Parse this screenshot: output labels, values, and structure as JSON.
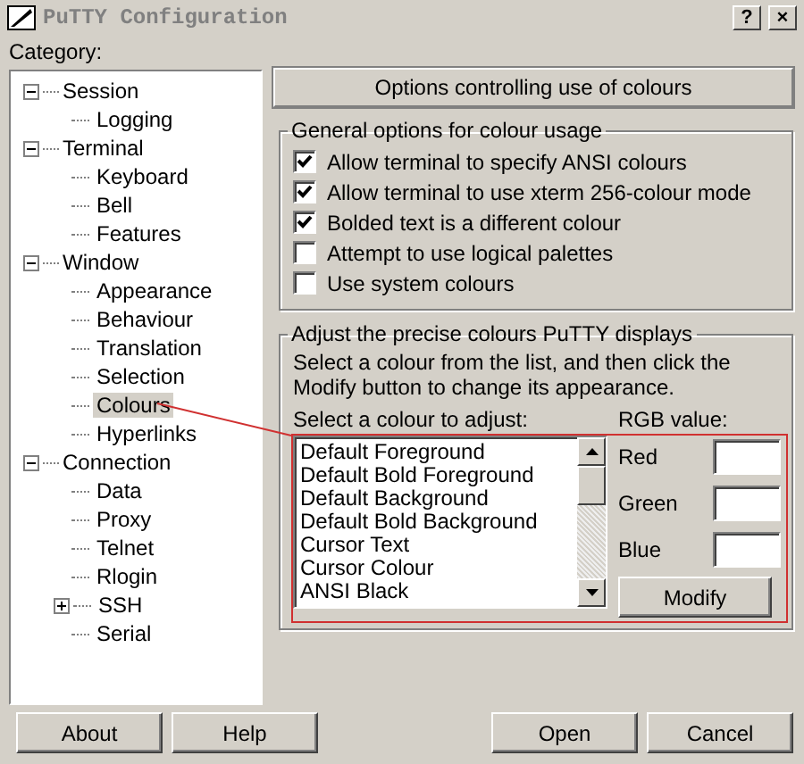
{
  "window": {
    "title": "PuTTY Configuration",
    "controls": [
      "?",
      "×"
    ]
  },
  "category_label": "Category:",
  "tree": [
    {
      "label": "Session",
      "expanded": true,
      "selected": false,
      "children": [
        {
          "label": "Logging",
          "selected": false
        }
      ]
    },
    {
      "label": "Terminal",
      "expanded": true,
      "selected": false,
      "children": [
        {
          "label": "Keyboard",
          "selected": false
        },
        {
          "label": "Bell",
          "selected": false
        },
        {
          "label": "Features",
          "selected": false
        }
      ]
    },
    {
      "label": "Window",
      "expanded": true,
      "selected": false,
      "children": [
        {
          "label": "Appearance",
          "selected": false
        },
        {
          "label": "Behaviour",
          "selected": false
        },
        {
          "label": "Translation",
          "selected": false
        },
        {
          "label": "Selection",
          "selected": false
        },
        {
          "label": "Colours",
          "selected": true
        },
        {
          "label": "Hyperlinks",
          "selected": false
        }
      ]
    },
    {
      "label": "Connection",
      "expanded": true,
      "selected": false,
      "children": [
        {
          "label": "Data",
          "selected": false
        },
        {
          "label": "Proxy",
          "selected": false
        },
        {
          "label": "Telnet",
          "selected": false
        },
        {
          "label": "Rlogin",
          "selected": false
        },
        {
          "label": "SSH",
          "expanded": false,
          "selected": false
        },
        {
          "label": "Serial",
          "selected": false
        }
      ]
    }
  ],
  "panel_title": "Options controlling use of colours",
  "general_group": {
    "title": "General options for colour usage",
    "options": [
      {
        "label": "Allow terminal to specify ANSI colours",
        "checked": true
      },
      {
        "label": "Allow terminal to use xterm 256-colour mode",
        "checked": true
      },
      {
        "label": "Bolded text is a different colour",
        "checked": true
      },
      {
        "label": "Attempt to use logical palettes",
        "checked": false
      },
      {
        "label": "Use system colours",
        "checked": false
      }
    ]
  },
  "adjust_group": {
    "title": "Adjust the precise colours PuTTY displays",
    "description": "Select a colour from the list, and then click the Modify button to change its appearance.",
    "list_label": "Select a colour to adjust:",
    "colours": [
      "Default Foreground",
      "Default Bold Foreground",
      "Default Background",
      "Default Bold Background",
      "Cursor Text",
      "Cursor Colour",
      "ANSI Black"
    ],
    "rgb_label": "RGB value:",
    "rgb_fields": [
      {
        "label": "Red"
      },
      {
        "label": "Green"
      },
      {
        "label": "Blue"
      }
    ],
    "modify_button": "Modify"
  },
  "buttons": [
    "About",
    "Help",
    "Open",
    "Cancel"
  ]
}
